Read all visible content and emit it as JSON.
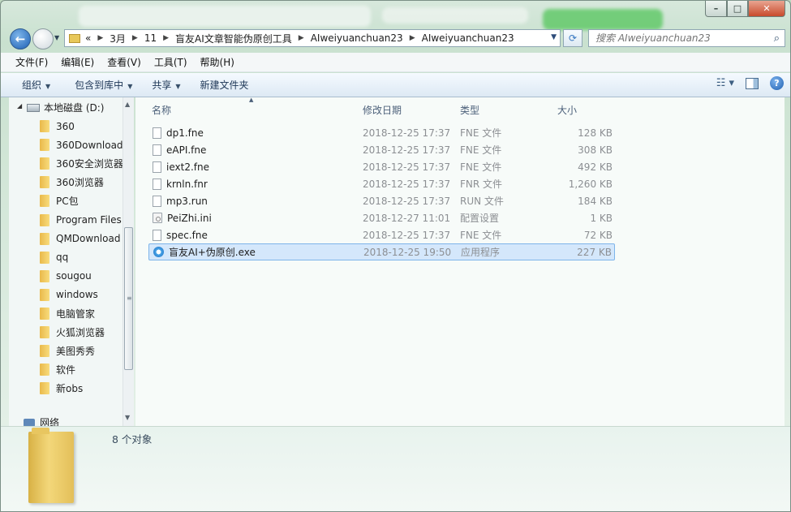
{
  "window": {
    "caption": {
      "minimize": "–",
      "maximize": "□",
      "close": "✕"
    }
  },
  "nav": {
    "breadcrumb": [
      "«",
      "3月",
      "11",
      "盲友AI文章智能伪原创工具",
      "AIweiyuanchuan23",
      "AIweiyuanchuan23"
    ],
    "search_placeholder": "搜索 AIweiyuanchuan23"
  },
  "menu": [
    "文件(F)",
    "编辑(E)",
    "查看(V)",
    "工具(T)",
    "帮助(H)"
  ],
  "toolbar": {
    "organize": "组织",
    "include_library": "包含到库中",
    "share": "共享",
    "new_folder": "新建文件夹"
  },
  "tree": {
    "drive": "本地磁盘 (D:)",
    "folders": [
      "360",
      "360Download",
      "360安全浏览器",
      "360浏览器",
      "PC包",
      "Program Files",
      "QMDownload",
      "qq",
      "sougou",
      "windows",
      "电脑管家",
      "火狐浏览器",
      "美图秀秀",
      "软件",
      "新obs"
    ],
    "network": "网络"
  },
  "columns": {
    "name": "名称",
    "date": "修改日期",
    "type": "类型",
    "size": "大小"
  },
  "files": [
    {
      "name": "dp1.fne",
      "date": "2018-12-25 17:37",
      "type": "FNE 文件",
      "size": "128 KB",
      "icon": "file-icon"
    },
    {
      "name": "eAPI.fne",
      "date": "2018-12-25 17:37",
      "type": "FNE 文件",
      "size": "308 KB",
      "icon": "file-icon"
    },
    {
      "name": "iext2.fne",
      "date": "2018-12-25 17:37",
      "type": "FNE 文件",
      "size": "492 KB",
      "icon": "file-icon"
    },
    {
      "name": "krnln.fnr",
      "date": "2018-12-25 17:37",
      "type": "FNR 文件",
      "size": "1,260 KB",
      "icon": "file-icon"
    },
    {
      "name": "mp3.run",
      "date": "2018-12-25 17:37",
      "type": "RUN 文件",
      "size": "184 KB",
      "icon": "file-icon"
    },
    {
      "name": "PeiZhi.ini",
      "date": "2018-12-27 11:01",
      "type": "配置设置",
      "size": "1 KB",
      "icon": "settings-file-icon"
    },
    {
      "name": "spec.fne",
      "date": "2018-12-25 17:37",
      "type": "FNE 文件",
      "size": "72 KB",
      "icon": "file-icon"
    },
    {
      "name": "盲友AI+伪原创.exe",
      "date": "2018-12-25 19:50",
      "type": "应用程序",
      "size": "227 KB",
      "icon": "app-icon",
      "selected": true
    }
  ],
  "details": {
    "count": "8 个对象"
  }
}
